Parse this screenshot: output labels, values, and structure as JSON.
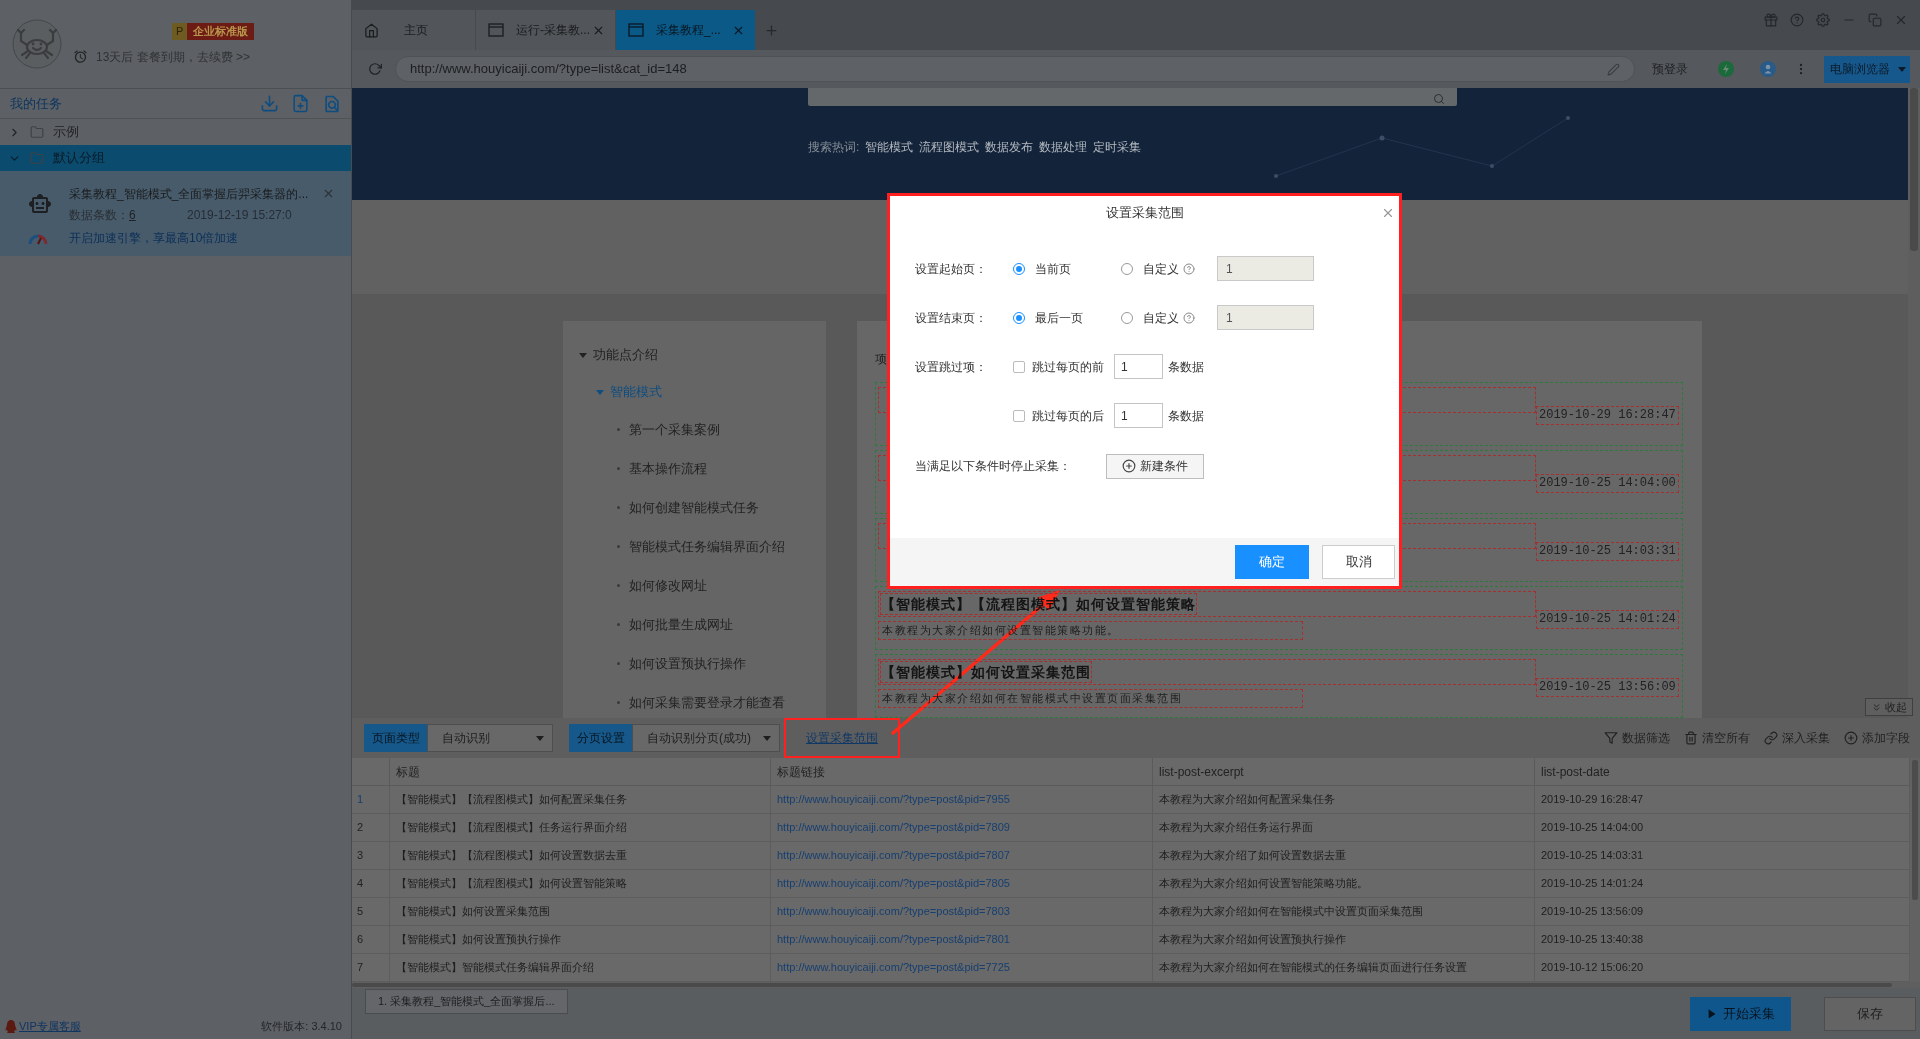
{
  "sidebar": {
    "account": {
      "badge_letter": "P",
      "badge": "企业标准版",
      "expiry": "13天后 套餐到期，去续费 >>"
    },
    "tasks_title": "我的任务",
    "groups": [
      {
        "label": "示例",
        "expanded": false,
        "selected": false
      },
      {
        "label": "默认分组",
        "expanded": true,
        "selected": true,
        "children": [
          {
            "title": "采集教程_智能模式_全面掌握后羿采集器的...",
            "count_label": "数据条数：",
            "count": "6",
            "time": "2019-12-19 15:27:0",
            "promo": "开启加速引擎，享最高10倍加速"
          }
        ]
      }
    ],
    "support": "VIP专属客服",
    "version": "软件版本: 3.4.10"
  },
  "browser": {
    "tabs": [
      {
        "kind": "home",
        "label": "主页",
        "selected": false
      },
      {
        "kind": "page",
        "label": "运行-采集教...",
        "selected": false
      },
      {
        "kind": "page",
        "label": "采集教程_...",
        "selected": true
      }
    ],
    "url": "http://www.houyicaiji.com/?type=list&cat_id=148",
    "prelogin": "预登录",
    "mode": "电脑浏览器"
  },
  "webpage": {
    "hot_label": "搜索热词:",
    "hot_terms": [
      "智能模式",
      "流程图模式",
      "数据发布",
      "数据处理",
      "定时采集"
    ],
    "nav": [
      {
        "label": "功能点介绍",
        "expanded": true,
        "selected": false,
        "children": [
          {
            "label": "智能模式",
            "expanded": true,
            "selected": true,
            "children": [
              {
                "label": "第一个采集案例",
                "selected": false
              },
              {
                "label": "基本操作流程",
                "selected": false
              },
              {
                "label": "如何创建智能模式任务",
                "selected": false
              },
              {
                "label": "智能模式任务编辑界面介绍",
                "selected": false
              },
              {
                "label": "如何修改网址",
                "selected": false
              },
              {
                "label": "如何批量生成网址",
                "selected": false
              },
              {
                "label": "如何设置预执行操作",
                "selected": false
              },
              {
                "label": "如何采集需要登录才能查看",
                "selected": false
              }
            ]
          }
        ]
      }
    ],
    "list_heading": "项",
    "articles": [
      {
        "date": "2019-10-29 16:28:47"
      },
      {
        "date": "2019-10-25 14:04:00"
      },
      {
        "date": "2019-10-25 14:03:31"
      },
      {
        "title": "【智能模式】【流程图模式】如何设置智能策略",
        "excerpt": "本教程为大家介绍如何设置智能策略功能。",
        "date": "2019-10-25 14:01:24"
      },
      {
        "title": "【智能模式】如何设置采集范围",
        "excerpt": "本教程为大家介绍如何在智能模式中设置页面采集范围",
        "date": "2019-10-25 13:56:09"
      }
    ],
    "collapse": "收起"
  },
  "toolbar": {
    "selectors": [
      {
        "label": "页面类型",
        "value": "自动识别"
      },
      {
        "label": "分页设置",
        "value": "自动识别分页(成功)"
      }
    ],
    "range_link": "设置采集范围",
    "actions": [
      {
        "kind": "filter",
        "label": "数据筛选"
      },
      {
        "kind": "clear",
        "label": "清空所有"
      },
      {
        "kind": "deep",
        "label": "深入采集"
      },
      {
        "kind": "add",
        "label": "添加字段"
      }
    ]
  },
  "table": {
    "columns": [
      {
        "label": "标题",
        "kind": "text"
      },
      {
        "label": "标题链接",
        "kind": "link"
      },
      {
        "label": "list-post-excerpt",
        "kind": "text"
      },
      {
        "label": "list-post-date",
        "kind": "text"
      }
    ],
    "rows": [
      {
        "index": "1",
        "selected": true,
        "cells": [
          "【智能模式】【流程图模式】如何配置采集任务",
          "http://www.houyicaiji.com/?type=post&pid=7955",
          "本教程为大家介绍如何配置采集任务",
          "2019-10-29 16:28:47"
        ]
      },
      {
        "index": "2",
        "selected": false,
        "cells": [
          "【智能模式】【流程图模式】任务运行界面介绍",
          "http://www.houyicaiji.com/?type=post&pid=7809",
          "本教程为大家介绍任务运行界面",
          "2019-10-25 14:04:00"
        ]
      },
      {
        "index": "3",
        "selected": false,
        "cells": [
          "【智能模式】【流程图模式】如何设置数据去重",
          "http://www.houyicaiji.com/?type=post&pid=7807",
          "本教程为大家介绍了如何设置数据去重",
          "2019-10-25 14:03:31"
        ]
      },
      {
        "index": "4",
        "selected": false,
        "cells": [
          "【智能模式】【流程图模式】如何设置智能策略",
          "http://www.houyicaiji.com/?type=post&pid=7805",
          "本教程为大家介绍如何设置智能策略功能。",
          "2019-10-25 14:01:24"
        ]
      },
      {
        "index": "5",
        "selected": false,
        "cells": [
          "【智能模式】如何设置采集范围",
          "http://www.houyicaiji.com/?type=post&pid=7803",
          "本教程为大家介绍如何在智能模式中设置页面采集范围",
          "2019-10-25 13:56:09"
        ]
      },
      {
        "index": "6",
        "selected": false,
        "cells": [
          "【智能模式】如何设置预执行操作",
          "http://www.houyicaiji.com/?type=post&pid=7801",
          "本教程为大家介绍如何设置预执行操作",
          "2019-10-25 13:40:38"
        ]
      },
      {
        "index": "7",
        "selected": false,
        "cells": [
          "【智能模式】智能模式任务编辑界面介绍",
          "http://www.houyicaiji.com/?type=post&pid=7725",
          "本教程为大家介绍如何在智能模式的任务编辑页面进行任务设置",
          "2019-10-12 15:06:20"
        ]
      }
    ]
  },
  "footer": {
    "task_tabs": [
      "1. 采集教程_智能模式_全面掌握后..."
    ],
    "start": "开始采集",
    "save": "保存"
  },
  "dialog": {
    "title": "设置采集范围",
    "page_rows": [
      {
        "label": "设置起始页：",
        "options": [
          {
            "label": "当前页",
            "selected": true,
            "help": false
          },
          {
            "label": "自定义",
            "selected": false,
            "help": true
          }
        ],
        "value": "1",
        "disabled": true
      },
      {
        "label": "设置结束页：",
        "options": [
          {
            "label": "最后一页",
            "selected": true,
            "help": false
          },
          {
            "label": "自定义",
            "selected": false,
            "help": true
          }
        ],
        "value": "1",
        "disabled": true
      }
    ],
    "skip_label": "设置跳过项：",
    "skip_rows": [
      {
        "label": "跳过每页的前",
        "checked": false,
        "value": "1",
        "unit": "条数据"
      },
      {
        "label": "跳过每页的后",
        "checked": false,
        "value": "1",
        "unit": "条数据"
      }
    ],
    "stop_label": "当满足以下条件时停止采集：",
    "add_condition": "新建条件",
    "confirm": "确定",
    "cancel": "取消"
  }
}
